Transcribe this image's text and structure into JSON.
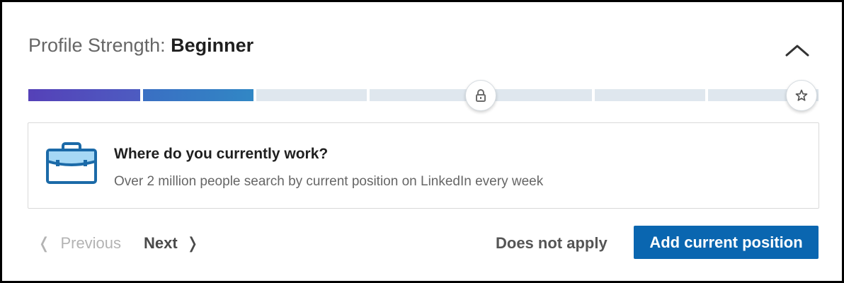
{
  "header": {
    "title_prefix": "Profile Strength:",
    "level": "Beginner",
    "collapse_icon": "chevron-up-icon"
  },
  "progress": {
    "segments_total": 7,
    "segments_filled": 2,
    "milestones": [
      {
        "icon": "lock-icon",
        "after_segment": 4
      },
      {
        "icon": "star-icon",
        "after_segment": 7
      }
    ],
    "fill_colors": [
      "#5541b8",
      "#3187c5"
    ],
    "empty_color": "#dfe7ee"
  },
  "card": {
    "icon": "briefcase-icon",
    "title": "Where do you currently work?",
    "description": "Over 2 million people search by current position on LinkedIn every week"
  },
  "footer": {
    "previous_label": "Previous",
    "next_label": "Next",
    "does_not_apply_label": "Does not apply",
    "primary_button_label": "Add current position",
    "primary_color": "#0a66b0"
  }
}
